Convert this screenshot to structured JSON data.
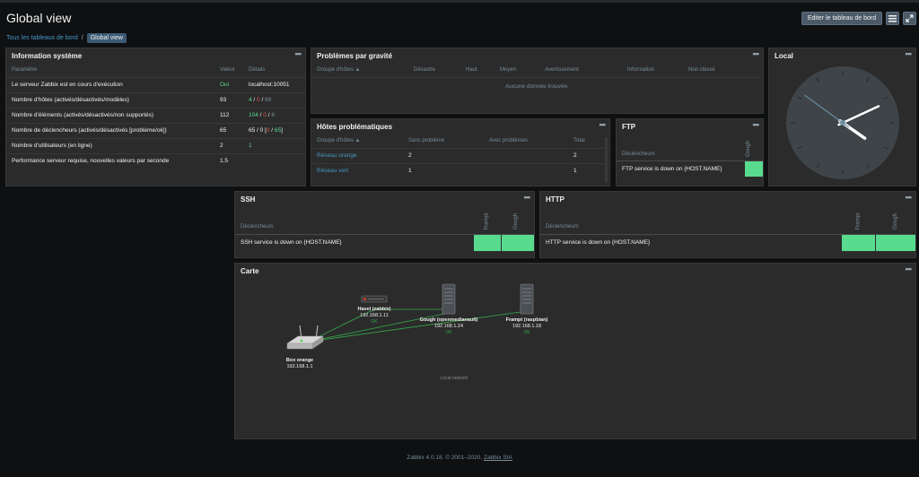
{
  "header": {
    "title": "Global view",
    "edit_button": "Editer le tableau de bord"
  },
  "breadcrumb": {
    "all": "Tous les tableaux de bord",
    "sep": "/",
    "current": "Global view"
  },
  "sysinfo": {
    "title": "Information système",
    "cols": [
      "Paramètre",
      "Valeur",
      "Détails"
    ],
    "rows": [
      {
        "param": "Le serveur Zabbix est en cours d'exécution",
        "value": "Oui",
        "details": "localhost:10051"
      },
      {
        "param": "Nombre d'hôtes (activés/désactivés/modèles)",
        "value": "93",
        "d1": "4",
        "s1": " / ",
        "d2": "0",
        "s2": " / ",
        "d3": "89"
      },
      {
        "param": "Nombre d'éléments (activés/désactivés/non supportés)",
        "value": "112",
        "d1": "104",
        "s1": " / ",
        "d2": "0",
        "s2": " / ",
        "d3": "8"
      },
      {
        "param": "Nombre de déclencheurs (activés/désactivés [problème/ok])",
        "value": "65",
        "d1": "65 / 0 [",
        "d2": "0",
        "s2": " / ",
        "d3": "65",
        "s3": "]"
      },
      {
        "param": "Nombre d'utilisateurs (en ligne)",
        "value": "2",
        "details": "1"
      },
      {
        "param": "Performance serveur requise, nouvelles valeurs par seconde",
        "value": "1.5",
        "details": ""
      }
    ]
  },
  "problems": {
    "title": "Problèmes par gravité",
    "cols": [
      "Groupe d'hôtes ▲",
      "Désastre",
      "Haut",
      "Moyen",
      "Avertissement",
      "Information",
      "Non classé"
    ],
    "empty": "Aucune donnée trouvée."
  },
  "hosts": {
    "title": "Hôtes problématiques",
    "cols": [
      "Groupe d'hôtes ▲",
      "Sans problème",
      "Avec problèmes",
      "Total"
    ],
    "rows": [
      {
        "group": "Réseau orange",
        "ok": "2",
        "problems": "",
        "total": "2"
      },
      {
        "group": "Réseau vert",
        "ok": "1",
        "problems": "",
        "total": "1"
      }
    ]
  },
  "ftp": {
    "title": "FTP",
    "col_trig": "Déclencheurs",
    "hosts": [
      "Gough"
    ],
    "trigger": "FTP service is down on {HOST.NAME}"
  },
  "clock": {
    "title": "Local",
    "hours": 4,
    "minutes": 10,
    "seconds": 51
  },
  "ssh": {
    "title": "SSH",
    "col_trig": "Déclencheurs",
    "hosts": [
      "Frampt",
      "Gough"
    ],
    "trigger": "SSH service is down on {HOST.NAME}"
  },
  "http": {
    "title": "HTTP",
    "col_trig": "Déclencheurs",
    "hosts": [
      "Frampt",
      "Gough"
    ],
    "trigger": "HTTP service is down on {HOST.NAME}"
  },
  "map": {
    "title": "Carte",
    "nodes": [
      {
        "name": "Havel (zabbix)",
        "ip": "192.168.1.11",
        "status": "OK"
      },
      {
        "name": "Gough (openmediavault)",
        "ip": "192.168.1.24",
        "status": "OK"
      },
      {
        "name": "Frampt (raspbian)",
        "ip": "192.168.1.18",
        "status": "OK"
      },
      {
        "name": "Box orange",
        "ip": "192.168.1.1",
        "status": ""
      }
    ],
    "label": "Local network"
  },
  "footer": {
    "text": "Zabbix 4.0.18. © 2001–2020, ",
    "link": "Zabbix SIA"
  },
  "colors": {
    "ok_green": "#59db8f",
    "link_blue": "#4796c4",
    "problem_red": "#e45959"
  }
}
